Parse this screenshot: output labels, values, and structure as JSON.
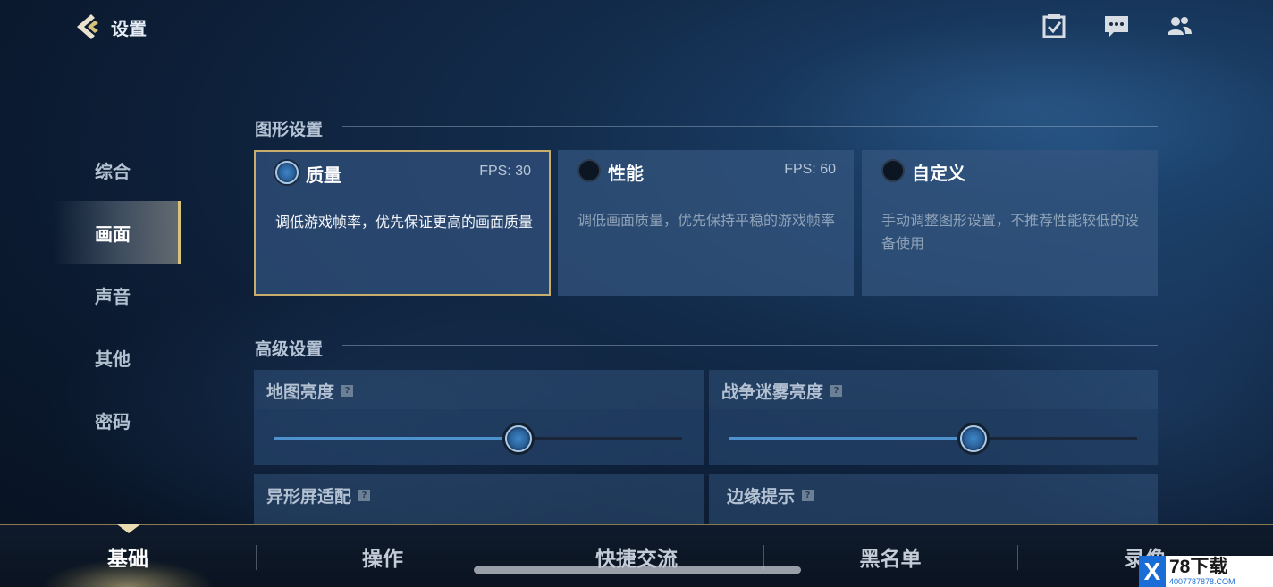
{
  "header": {
    "title": "设置",
    "back_icon": "back-arrow-icon",
    "icons": [
      "task-checklist-icon",
      "chat-bubble-icon",
      "friends-icon"
    ]
  },
  "sidebar": {
    "items": [
      {
        "label": "综合",
        "active": false
      },
      {
        "label": "画面",
        "active": true
      },
      {
        "label": "声音",
        "active": false
      },
      {
        "label": "其他",
        "active": false
      },
      {
        "label": "密码",
        "active": false
      }
    ]
  },
  "graphics": {
    "title": "图形设置",
    "options": [
      {
        "name": "质量",
        "fps": "FPS: 30",
        "desc": "调低游戏帧率，优先保证更高的画面质量",
        "selected": true
      },
      {
        "name": "性能",
        "fps": "FPS: 60",
        "desc": "调低画面质量，优先保持平稳的游戏帧率",
        "selected": false
      },
      {
        "name": "自定义",
        "fps": "",
        "desc": "手动调整图形设置，不推荐性能较低的设备使用",
        "selected": false
      }
    ]
  },
  "advanced": {
    "title": "高级设置",
    "sliders": [
      {
        "label": "地图亮度",
        "value": 0.6
      },
      {
        "label": "战争迷雾亮度",
        "value": 0.6
      }
    ],
    "more": [
      {
        "label": "异形屏适配"
      },
      {
        "label": "边缘提示"
      }
    ],
    "help_glyph": "?"
  },
  "tabs": [
    {
      "label": "基础",
      "active": true
    },
    {
      "label": "操作",
      "active": false
    },
    {
      "label": "快捷交流",
      "active": false
    },
    {
      "label": "黑名单",
      "active": false
    },
    {
      "label": "录像",
      "active": false
    }
  ],
  "watermark": {
    "x": "X",
    "main": "78下载",
    "sub": "4007787878.COM"
  },
  "colors": {
    "accent_gold": "#c7ae6c",
    "slider_blue": "#4d91cf",
    "card_bg": "#34567f"
  }
}
